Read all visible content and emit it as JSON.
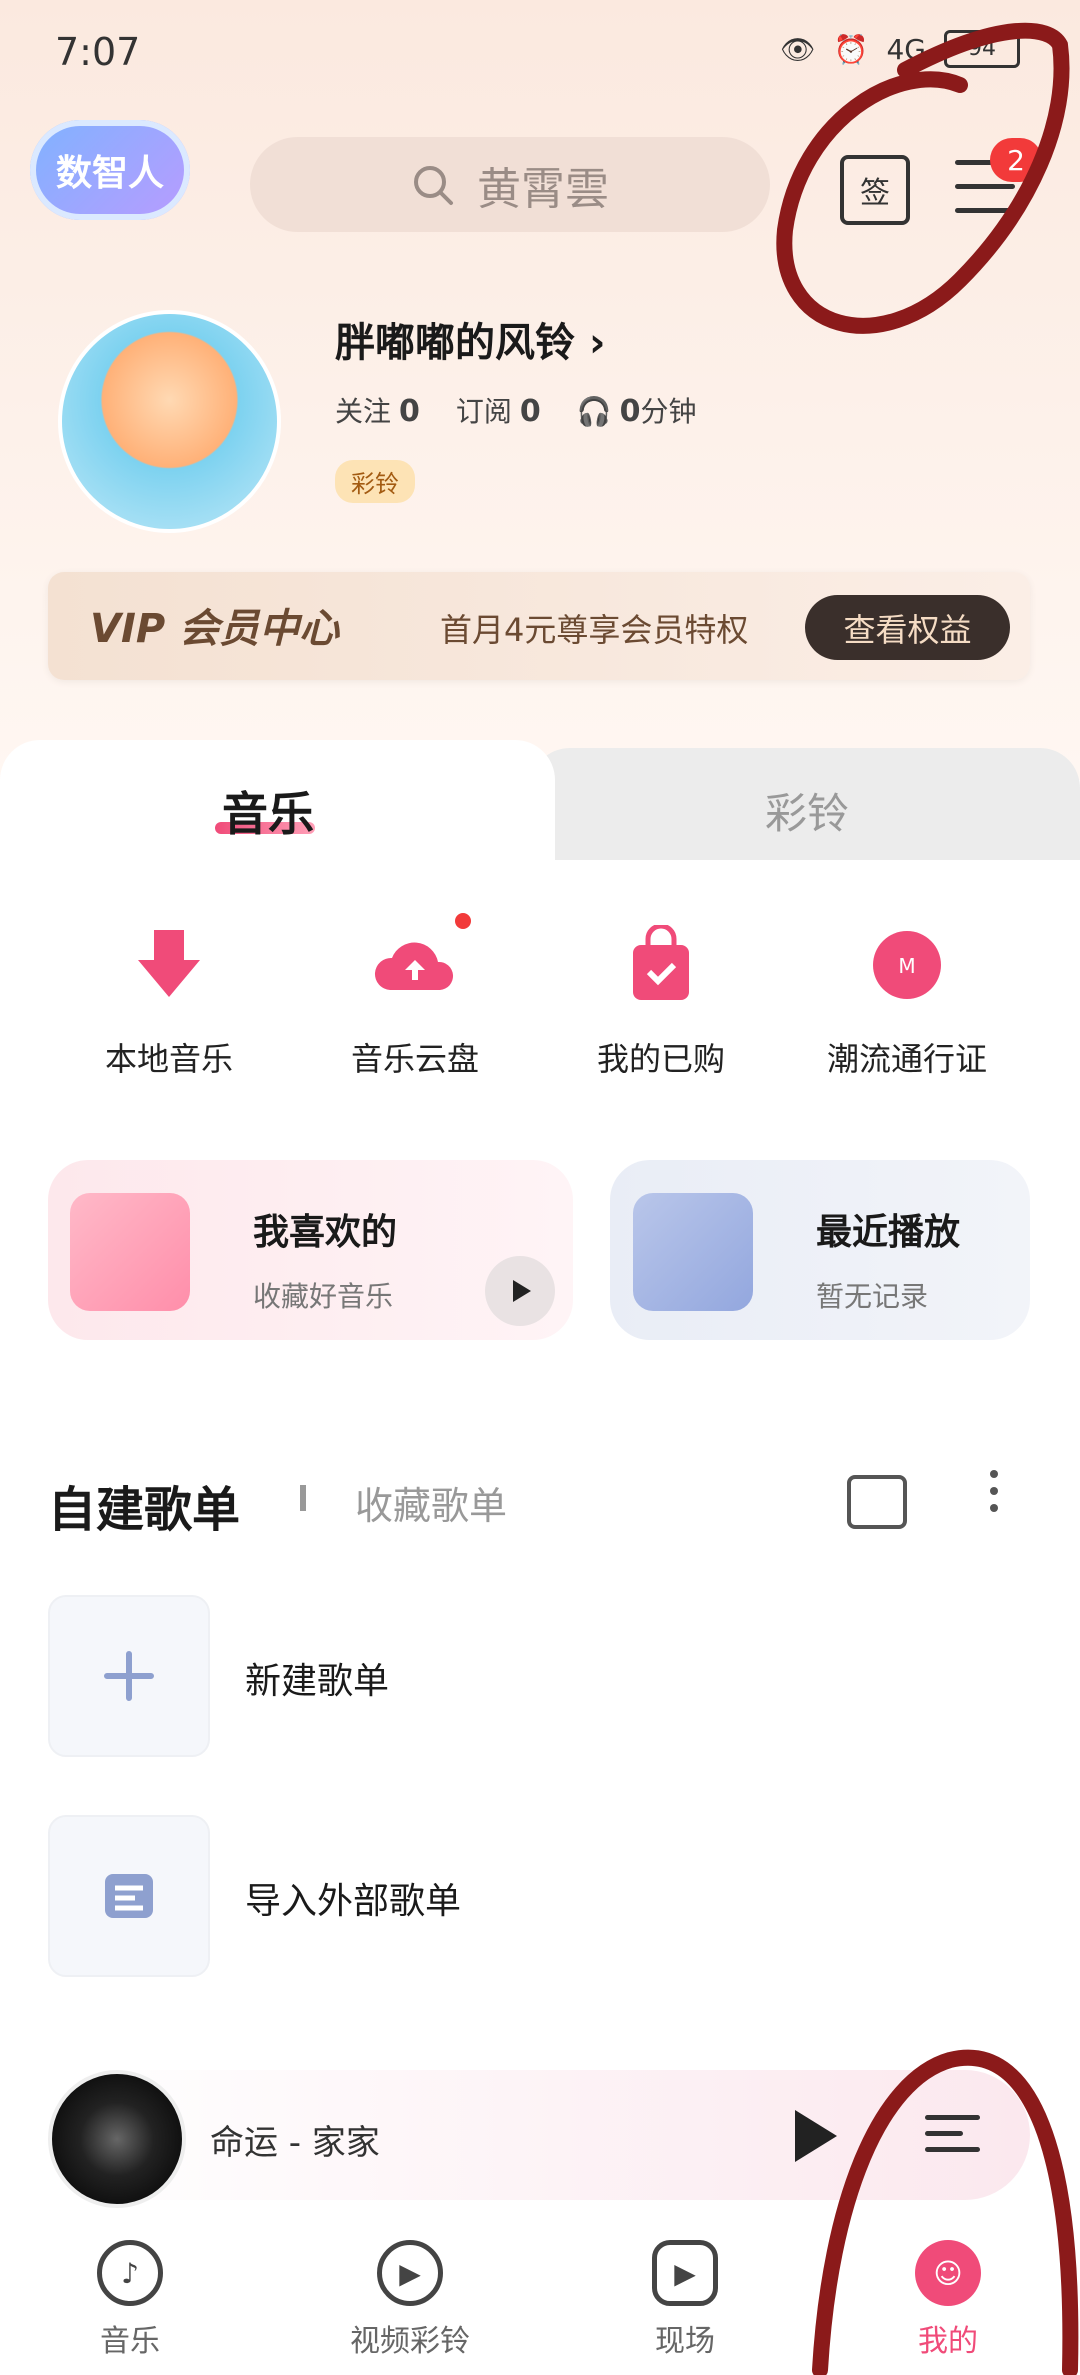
{
  "status_bar": {
    "time": "7:07",
    "network": "4G",
    "battery": "94"
  },
  "header": {
    "logo_text": "数智人",
    "search_placeholder": "黄霄雲",
    "sign_label": "签",
    "menu_badge": "2"
  },
  "profile": {
    "name": "胖嘟嘟的风铃",
    "follow_label": "关注",
    "follow_count": "0",
    "subscribe_label": "订阅",
    "subscribe_count": "0",
    "listen_value": "0",
    "listen_unit": "分钟",
    "tag": "彩铃"
  },
  "vip": {
    "title": "VIP 会员中心",
    "desc": "首月4元尊享会员特权",
    "button": "查看权益"
  },
  "tabs": {
    "music": "音乐",
    "ringtone": "彩铃"
  },
  "quick_actions": [
    {
      "label": "本地音乐",
      "icon": "download-icon",
      "color": "#f04b79"
    },
    {
      "label": "音乐云盘",
      "icon": "cloud-upload-icon",
      "color": "#f04b79"
    },
    {
      "label": "我的已购",
      "icon": "shopping-bag-icon",
      "color": "#f04b79"
    },
    {
      "label": "潮流通行证",
      "icon": "migu-pass-icon",
      "color": "#f04b79"
    }
  ],
  "cards": {
    "like_title": "我喜欢的",
    "like_sub": "收藏好音乐",
    "recent_title": "最近播放",
    "recent_sub": "暂无记录"
  },
  "playlists": {
    "tab_self": "自建歌单",
    "tab_fav": "收藏歌单",
    "new_label": "新建歌单",
    "import_label": "导入外部歌单"
  },
  "mini_player": {
    "song": "命运 - 家家"
  },
  "nav": [
    {
      "label": "音乐",
      "icon": "music-note-icon"
    },
    {
      "label": "视频彩铃",
      "icon": "bell-icon"
    },
    {
      "label": "现场",
      "icon": "play-icon"
    },
    {
      "label": "我的",
      "icon": "smile-icon"
    }
  ],
  "colors": {
    "accent": "#f04b79",
    "annotation": "#8b1a1a"
  }
}
